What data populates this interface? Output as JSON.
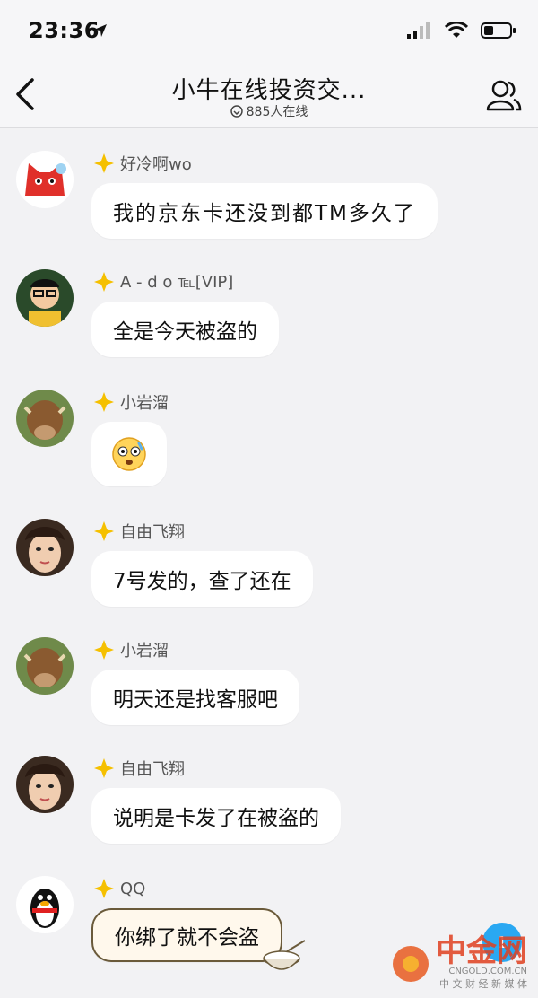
{
  "status_bar": {
    "time": "23:36"
  },
  "header": {
    "title": "小牛在线投资交...",
    "online_count": "885人在线"
  },
  "messages": [
    {
      "sender": "好冷啊wo",
      "text": "我的京东卡还没到都TM多久了",
      "avatar": "fox-avatar"
    },
    {
      "sender": "A - d o",
      "sender_badge": "℡[VIP]",
      "text": "全是今天被盗的",
      "avatar": "cartoon-man-avatar"
    },
    {
      "sender": "小岩溜",
      "text": "",
      "emoji": "😰",
      "avatar": "cow-avatar"
    },
    {
      "sender": "自由飞翔",
      "text": "7号发的，查了还在",
      "avatar": "woman-avatar"
    },
    {
      "sender": "小岩溜",
      "text": "明天还是找客服吧",
      "avatar": "cow-avatar"
    },
    {
      "sender": "自由飞翔",
      "text": "说明是卡发了在被盗的",
      "avatar": "woman-avatar"
    },
    {
      "sender": "QQ",
      "text": "你绑了就不会盗",
      "avatar": "penguin-avatar"
    }
  ],
  "unread_badge": "1",
  "watermark": {
    "brand": "中金网",
    "domain": "CNGOLD.COM.CN",
    "slogan": "中 文 财 经 新 媒 体"
  },
  "colors": {
    "badge_yellow": "#f5c000",
    "bubble": "#ffffff",
    "bg": "#f2f2f4",
    "accent_blue": "#2aa8f2"
  }
}
